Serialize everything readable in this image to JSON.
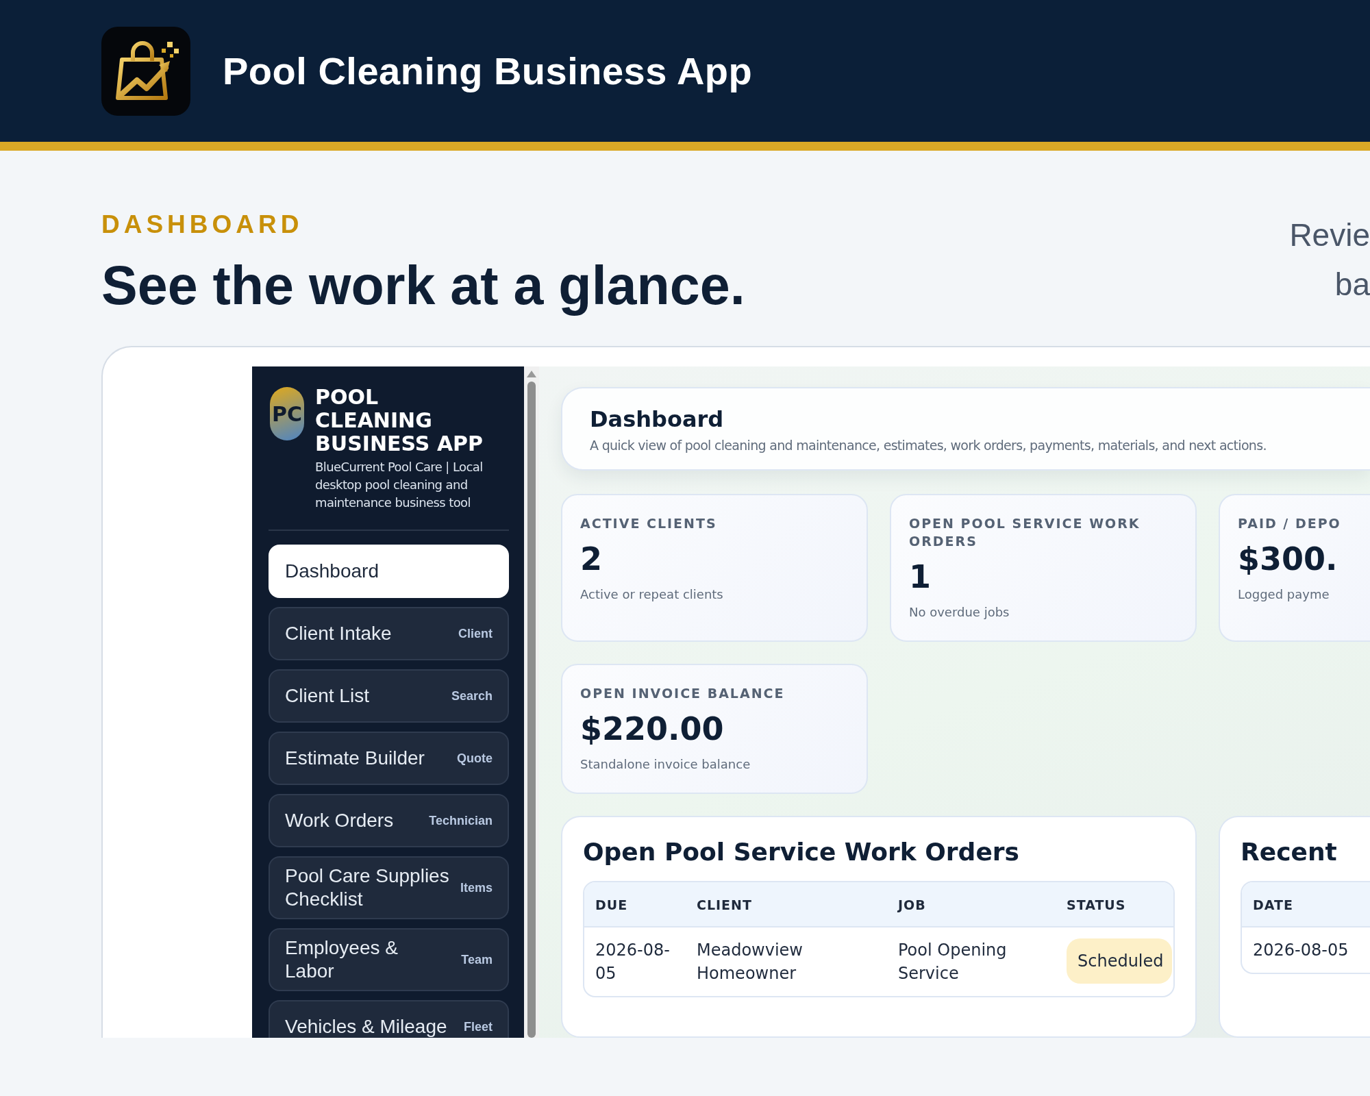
{
  "header": {
    "title": "Pool Cleaning Business App"
  },
  "hero": {
    "eyebrow": "DASHBOARD",
    "heading": "See the work at a glance.",
    "intro_lines": [
      "Revie",
      "ba"
    ]
  },
  "sidebar": {
    "logo_text": "PC",
    "title": "POOL CLEANING BUSINESS APP",
    "subtitle": "BlueCurrent Pool Care | Local desktop pool cleaning and maintenance business tool",
    "items": [
      {
        "label": "Dashboard",
        "selected": true
      },
      {
        "label": "Client Intake",
        "tag": "Client",
        "selected": false
      },
      {
        "label": "Client List",
        "tag": "Search",
        "selected": false
      },
      {
        "label": "Estimate Builder",
        "tag": "Quote",
        "selected": false
      },
      {
        "label": "Work Orders",
        "tag": "Technician",
        "selected": false
      },
      {
        "label": "Pool Care Supplies Checklist",
        "tag": "Items",
        "selected": false
      },
      {
        "label": "Employees & Labor",
        "tag": "Team",
        "selected": false
      },
      {
        "label": "Vehicles & Mileage",
        "tag": "Fleet",
        "selected": false
      }
    ]
  },
  "page_header": {
    "title": "Dashboard",
    "description": "A quick view of pool cleaning and maintenance, estimates, work orders, payments, materials, and next actions."
  },
  "stats": [
    {
      "label": "ACTIVE CLIENTS",
      "value": "2",
      "note": "Active or repeat clients"
    },
    {
      "label": "OPEN POOL SERVICE WORK ORDERS",
      "value": "1",
      "note": "No overdue jobs"
    },
    {
      "label": "PAID / DEPO",
      "value": "$300.",
      "note": "Logged payme"
    },
    {
      "label": "OPEN INVOICE BALANCE",
      "value": "$220.00",
      "note": "Standalone invoice balance"
    }
  ],
  "panels": [
    {
      "title": "Open Pool Service Work Orders",
      "columns": [
        "DUE",
        "CLIENT",
        "JOB",
        "STATUS"
      ],
      "rows": [
        [
          {
            "kind": "text",
            "text": "2026-08-05"
          },
          {
            "kind": "text",
            "text": "Meadowview Homeowner"
          },
          {
            "kind": "text",
            "text": "Pool Opening Service"
          },
          {
            "kind": "badge",
            "text": "Scheduled"
          }
        ]
      ]
    },
    {
      "title": "Recent",
      "columns": [
        "DATE"
      ],
      "rows": [
        [
          {
            "kind": "text",
            "text": "2026-08-05"
          }
        ]
      ]
    }
  ]
}
